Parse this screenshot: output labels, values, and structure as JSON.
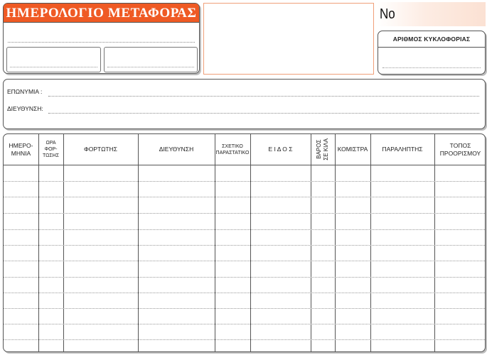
{
  "header": {
    "title": "ΗΜΕΡΟΛΟΓΙΟ ΜΕΤΑΦΟΡΑΣ",
    "number_label": "Νο",
    "plate_label": "ΑΡΙΘΜΟΣ ΚΥΚΛΟΦΟΡΙΑΣ",
    "accent_color": "#ef5a24"
  },
  "info": {
    "name_label": "ΕΠΩΝΥΜΙΑ :",
    "address_label": "ΔΙΕΥΘΥΝΣΗ:"
  },
  "table": {
    "columns": [
      {
        "line1": "ΗΜΕΡΟ-",
        "line2": "ΜΗΝΙΑ",
        "line3": ""
      },
      {
        "line1": "ΩΡΑ",
        "line2": "ΦΟΡ-",
        "line3": "ΤΩΣΗΣ"
      },
      {
        "line1": "ΦΟΡΤΩΤΗΣ",
        "line2": "",
        "line3": ""
      },
      {
        "line1": "ΔΙΕΥΘΥΝΣΗ",
        "line2": "",
        "line3": ""
      },
      {
        "line1": "ΣΧΕΤΙΚΟ",
        "line2": "ΠΑΡΑΣΤΑΤΙΚΟ",
        "line3": ""
      },
      {
        "line1": "Ε Ι Δ Ο Σ",
        "line2": "",
        "line3": ""
      },
      {
        "line1": "ΒΑΡΟΣ",
        "line2": "ΣΕ ΚΙΛΑ",
        "line3": ""
      },
      {
        "line1": "ΚΟΜΙΣΤΡΑ",
        "line2": "",
        "line3": ""
      },
      {
        "line1": "ΠΑΡΑΛΗΠΤΗΣ",
        "line2": "",
        "line3": ""
      },
      {
        "line1": "ΤΟΠΟΣ",
        "line2": "ΠΡΟΟΡΙΣΜΟΥ",
        "line3": ""
      }
    ]
  }
}
